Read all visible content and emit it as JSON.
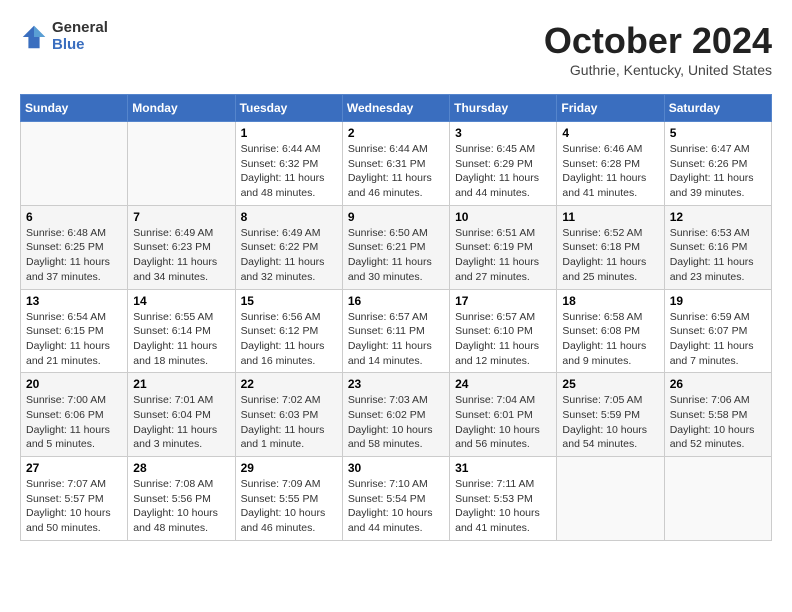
{
  "header": {
    "logo_general": "General",
    "logo_blue": "Blue",
    "month_title": "October 2024",
    "location": "Guthrie, Kentucky, United States"
  },
  "days_of_week": [
    "Sunday",
    "Monday",
    "Tuesday",
    "Wednesday",
    "Thursday",
    "Friday",
    "Saturday"
  ],
  "weeks": [
    [
      {
        "day": "",
        "info": ""
      },
      {
        "day": "",
        "info": ""
      },
      {
        "day": "1",
        "info": "Sunrise: 6:44 AM\nSunset: 6:32 PM\nDaylight: 11 hours and 48 minutes."
      },
      {
        "day": "2",
        "info": "Sunrise: 6:44 AM\nSunset: 6:31 PM\nDaylight: 11 hours and 46 minutes."
      },
      {
        "day": "3",
        "info": "Sunrise: 6:45 AM\nSunset: 6:29 PM\nDaylight: 11 hours and 44 minutes."
      },
      {
        "day": "4",
        "info": "Sunrise: 6:46 AM\nSunset: 6:28 PM\nDaylight: 11 hours and 41 minutes."
      },
      {
        "day": "5",
        "info": "Sunrise: 6:47 AM\nSunset: 6:26 PM\nDaylight: 11 hours and 39 minutes."
      }
    ],
    [
      {
        "day": "6",
        "info": "Sunrise: 6:48 AM\nSunset: 6:25 PM\nDaylight: 11 hours and 37 minutes."
      },
      {
        "day": "7",
        "info": "Sunrise: 6:49 AM\nSunset: 6:23 PM\nDaylight: 11 hours and 34 minutes."
      },
      {
        "day": "8",
        "info": "Sunrise: 6:49 AM\nSunset: 6:22 PM\nDaylight: 11 hours and 32 minutes."
      },
      {
        "day": "9",
        "info": "Sunrise: 6:50 AM\nSunset: 6:21 PM\nDaylight: 11 hours and 30 minutes."
      },
      {
        "day": "10",
        "info": "Sunrise: 6:51 AM\nSunset: 6:19 PM\nDaylight: 11 hours and 27 minutes."
      },
      {
        "day": "11",
        "info": "Sunrise: 6:52 AM\nSunset: 6:18 PM\nDaylight: 11 hours and 25 minutes."
      },
      {
        "day": "12",
        "info": "Sunrise: 6:53 AM\nSunset: 6:16 PM\nDaylight: 11 hours and 23 minutes."
      }
    ],
    [
      {
        "day": "13",
        "info": "Sunrise: 6:54 AM\nSunset: 6:15 PM\nDaylight: 11 hours and 21 minutes."
      },
      {
        "day": "14",
        "info": "Sunrise: 6:55 AM\nSunset: 6:14 PM\nDaylight: 11 hours and 18 minutes."
      },
      {
        "day": "15",
        "info": "Sunrise: 6:56 AM\nSunset: 6:12 PM\nDaylight: 11 hours and 16 minutes."
      },
      {
        "day": "16",
        "info": "Sunrise: 6:57 AM\nSunset: 6:11 PM\nDaylight: 11 hours and 14 minutes."
      },
      {
        "day": "17",
        "info": "Sunrise: 6:57 AM\nSunset: 6:10 PM\nDaylight: 11 hours and 12 minutes."
      },
      {
        "day": "18",
        "info": "Sunrise: 6:58 AM\nSunset: 6:08 PM\nDaylight: 11 hours and 9 minutes."
      },
      {
        "day": "19",
        "info": "Sunrise: 6:59 AM\nSunset: 6:07 PM\nDaylight: 11 hours and 7 minutes."
      }
    ],
    [
      {
        "day": "20",
        "info": "Sunrise: 7:00 AM\nSunset: 6:06 PM\nDaylight: 11 hours and 5 minutes."
      },
      {
        "day": "21",
        "info": "Sunrise: 7:01 AM\nSunset: 6:04 PM\nDaylight: 11 hours and 3 minutes."
      },
      {
        "day": "22",
        "info": "Sunrise: 7:02 AM\nSunset: 6:03 PM\nDaylight: 11 hours and 1 minute."
      },
      {
        "day": "23",
        "info": "Sunrise: 7:03 AM\nSunset: 6:02 PM\nDaylight: 10 hours and 58 minutes."
      },
      {
        "day": "24",
        "info": "Sunrise: 7:04 AM\nSunset: 6:01 PM\nDaylight: 10 hours and 56 minutes."
      },
      {
        "day": "25",
        "info": "Sunrise: 7:05 AM\nSunset: 5:59 PM\nDaylight: 10 hours and 54 minutes."
      },
      {
        "day": "26",
        "info": "Sunrise: 7:06 AM\nSunset: 5:58 PM\nDaylight: 10 hours and 52 minutes."
      }
    ],
    [
      {
        "day": "27",
        "info": "Sunrise: 7:07 AM\nSunset: 5:57 PM\nDaylight: 10 hours and 50 minutes."
      },
      {
        "day": "28",
        "info": "Sunrise: 7:08 AM\nSunset: 5:56 PM\nDaylight: 10 hours and 48 minutes."
      },
      {
        "day": "29",
        "info": "Sunrise: 7:09 AM\nSunset: 5:55 PM\nDaylight: 10 hours and 46 minutes."
      },
      {
        "day": "30",
        "info": "Sunrise: 7:10 AM\nSunset: 5:54 PM\nDaylight: 10 hours and 44 minutes."
      },
      {
        "day": "31",
        "info": "Sunrise: 7:11 AM\nSunset: 5:53 PM\nDaylight: 10 hours and 41 minutes."
      },
      {
        "day": "",
        "info": ""
      },
      {
        "day": "",
        "info": ""
      }
    ]
  ]
}
